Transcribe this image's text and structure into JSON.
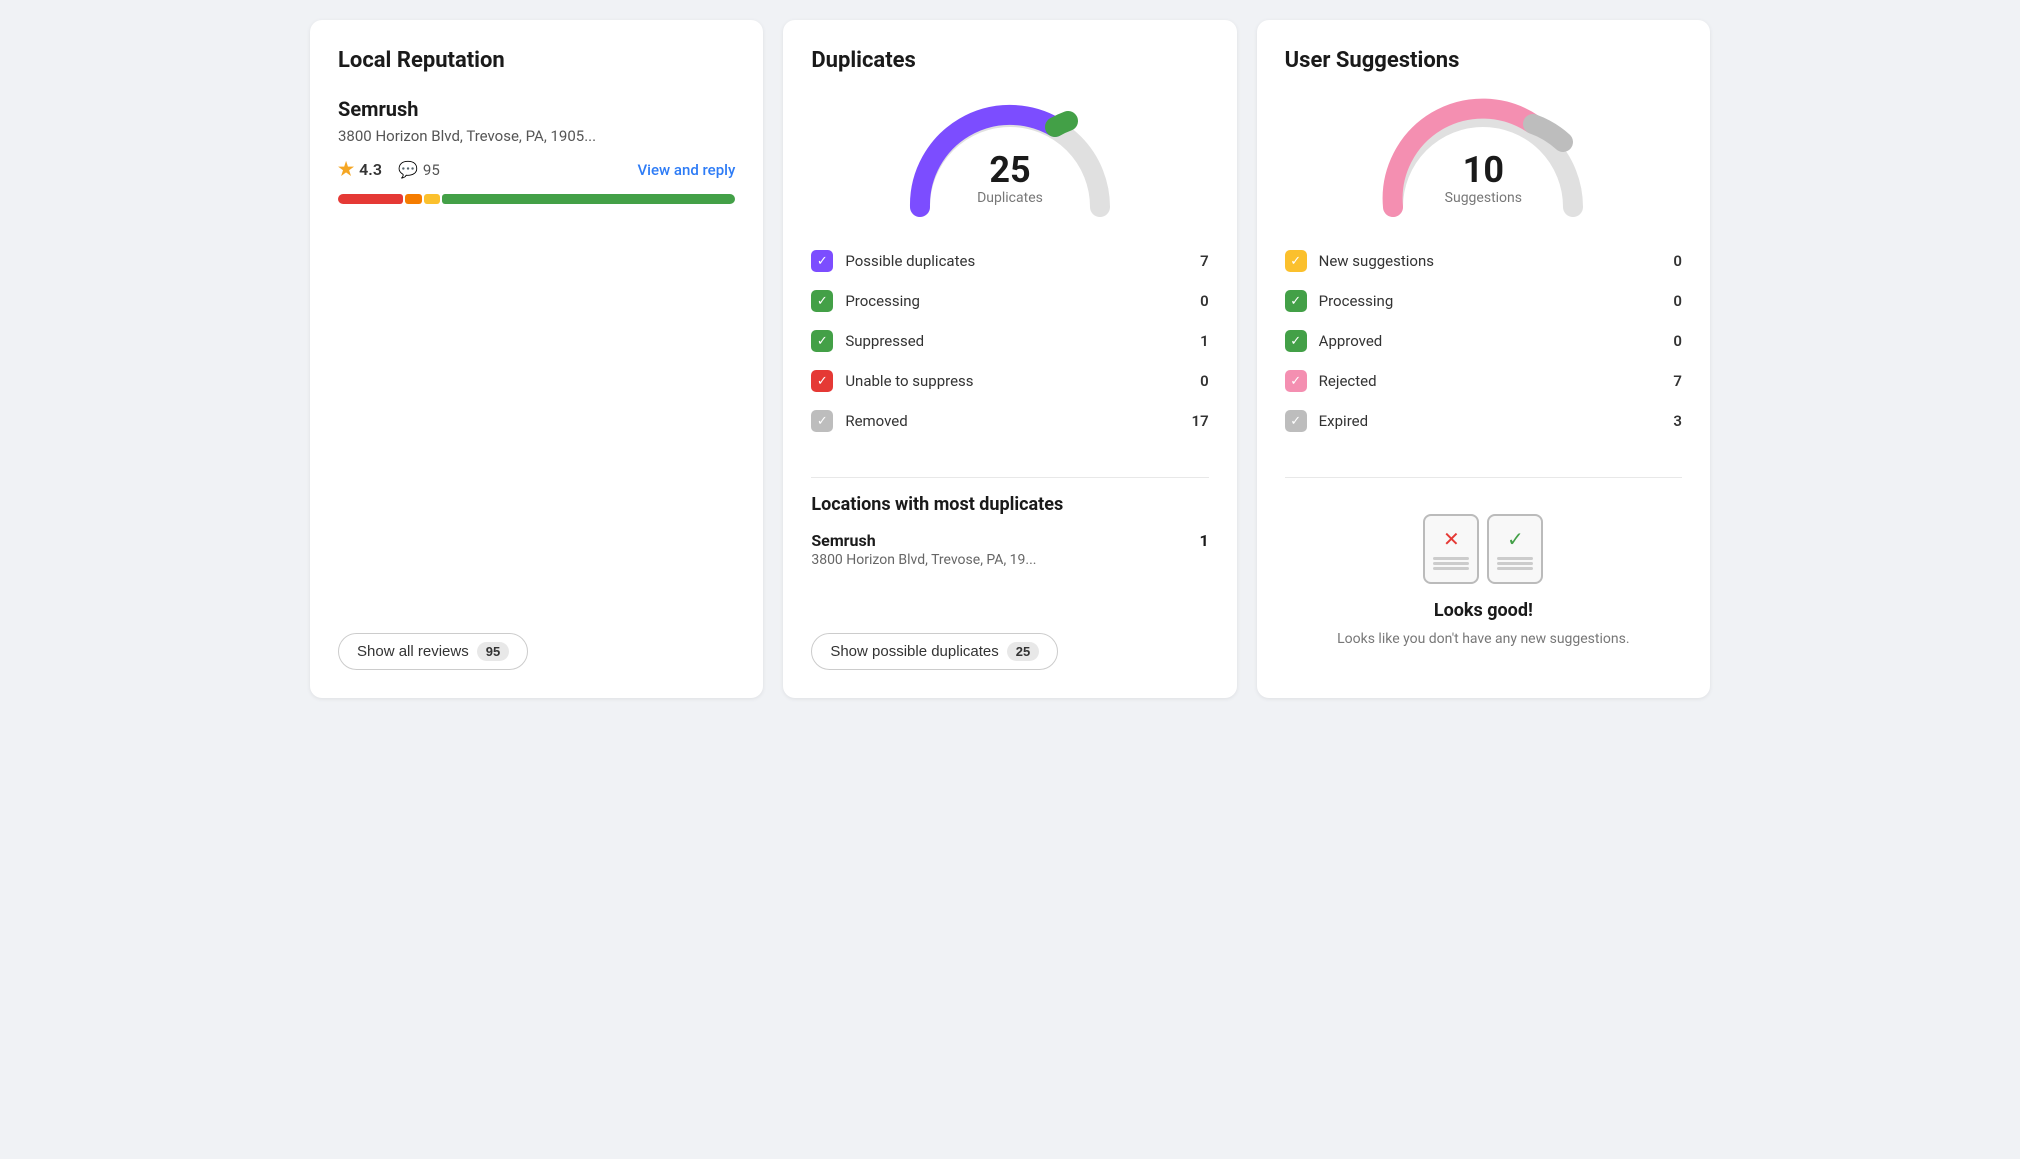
{
  "localReputation": {
    "title": "Local Reputation",
    "businessName": "Semrush",
    "businessAddress": "3800 Horizon Blvd, Trevose, PA, 1905...",
    "rating": "4.3",
    "reviewCount": "95",
    "viewReplyLabel": "View and reply",
    "showAllBtn": "Show all reviews",
    "showAllCount": "95"
  },
  "duplicates": {
    "title": "Duplicates",
    "gaugeNumber": "25",
    "gaugeLabel": "Duplicates",
    "stats": [
      {
        "label": "Possible duplicates",
        "count": "7",
        "colorClass": "check-purple"
      },
      {
        "label": "Processing",
        "count": "0",
        "colorClass": "check-green"
      },
      {
        "label": "Suppressed",
        "count": "1",
        "colorClass": "check-green"
      },
      {
        "label": "Unable to suppress",
        "count": "0",
        "colorClass": "check-red"
      },
      {
        "label": "Removed",
        "count": "17",
        "colorClass": "check-gray"
      }
    ],
    "locationsSectionTitle": "Locations with most duplicates",
    "locations": [
      {
        "name": "Semrush",
        "count": "1",
        "address": "3800 Horizon Blvd, Trevose, PA, 19..."
      }
    ],
    "showDuplicatesBtn": "Show possible duplicates",
    "showDuplicatesCount": "25"
  },
  "userSuggestions": {
    "title": "User Suggestions",
    "gaugeNumber": "10",
    "gaugeLabel": "Suggestions",
    "stats": [
      {
        "label": "New suggestions",
        "count": "0",
        "colorClass": "check-yellow"
      },
      {
        "label": "Processing",
        "count": "0",
        "colorClass": "check-green"
      },
      {
        "label": "Approved",
        "count": "0",
        "colorClass": "check-green"
      },
      {
        "label": "Rejected",
        "count": "7",
        "colorClass": "check-pink"
      },
      {
        "label": "Expired",
        "count": "3",
        "colorClass": "check-gray"
      }
    ],
    "looksGoodTitle": "Looks good!",
    "looksGoodDesc": "Looks like you don't have any new suggestions."
  }
}
